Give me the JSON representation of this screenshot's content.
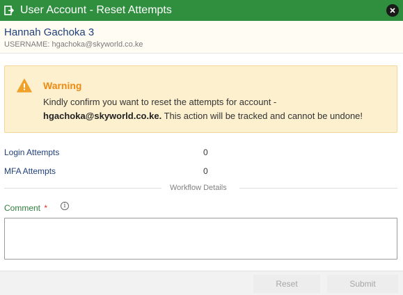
{
  "window": {
    "title": "User Account - Reset Attempts",
    "icon": "account-icon",
    "close_icon": "close-icon",
    "accent": "#2f8f3e"
  },
  "header": {
    "name": "Hannah Gachoka 3",
    "username": "USERNAME: hgachoka@skyworld.co.ke"
  },
  "warning": {
    "title": "Warning",
    "icon": "warning-icon",
    "line1": "Kindly confirm you want to reset the attempts for account -",
    "account": "hgachoka@skyworld.co.ke.",
    "line2_rest": " This action will be tracked and cannot be undone!",
    "color": "#ef8a12"
  },
  "fields": [
    {
      "label": "Login Attempts",
      "value": "0"
    },
    {
      "label": "MFA Attempts",
      "value": "0"
    }
  ],
  "workflow": {
    "divider_label": "Workflow Details",
    "comment_label": "Comment",
    "required_mark": "*",
    "info_icon": "info-icon",
    "comment_value": ""
  },
  "footer": {
    "reset_label": "Reset",
    "submit_label": "Submit"
  }
}
